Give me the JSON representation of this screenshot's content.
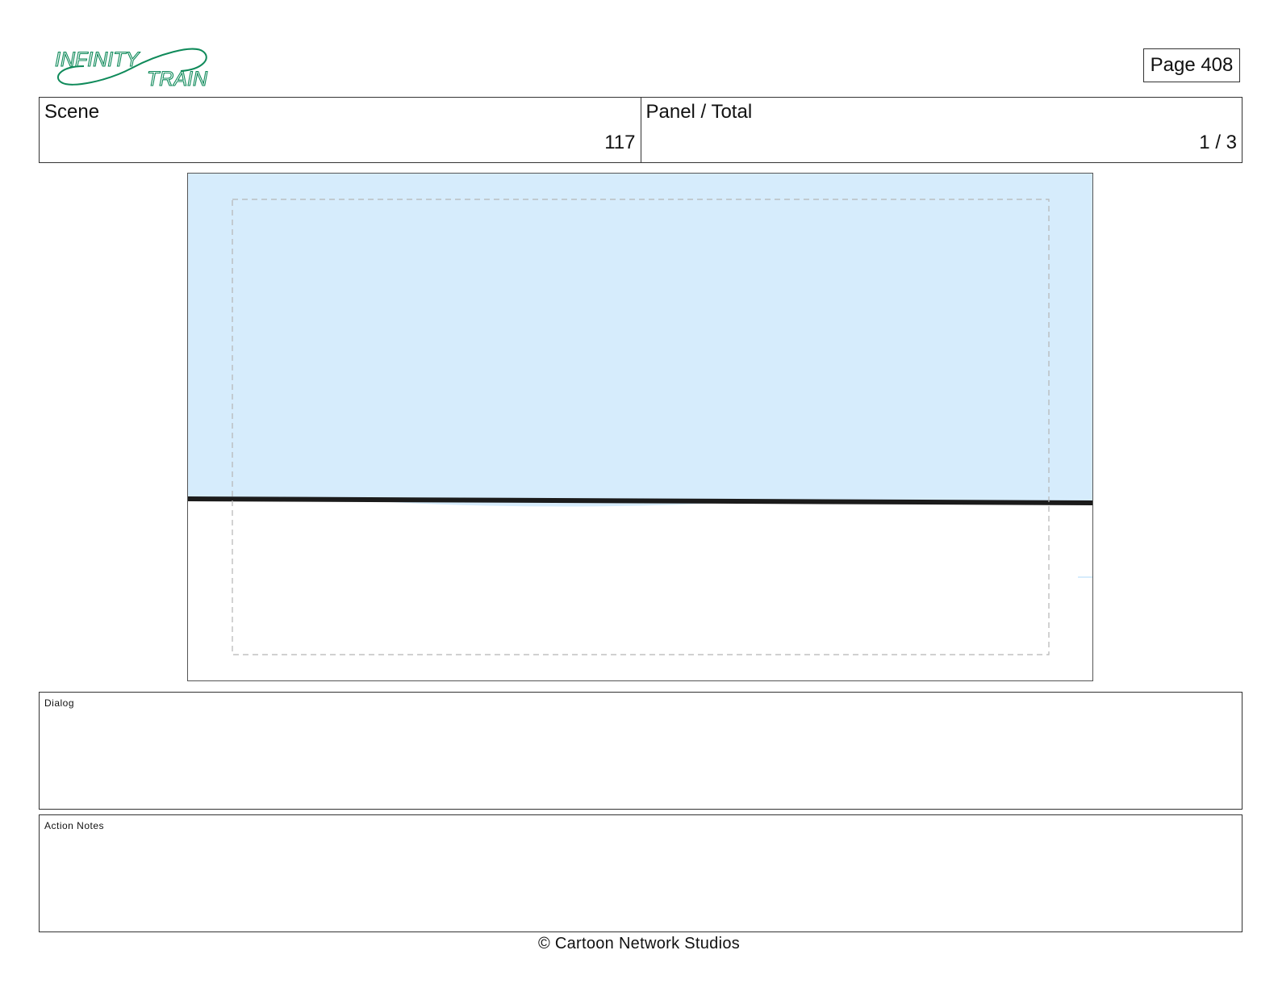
{
  "header": {
    "logo_text_line1": "INFINITY",
    "logo_text_line2": "TRAIN",
    "page_label": "Page 408",
    "brand_color": "#0f8a5a"
  },
  "info": {
    "scene_label": "Scene",
    "scene_value": "117",
    "panel_label": "Panel / Total",
    "panel_value": "1 / 3"
  },
  "panel": {
    "sky_color": "#d6ecfc",
    "horizon_color": "#1b1b1b",
    "safe_area_color": "#b5b5b5"
  },
  "dialog": {
    "label": "Dialog",
    "text": ""
  },
  "action_notes": {
    "label": "Action Notes",
    "text": ""
  },
  "footer": {
    "copyright": "© Cartoon Network Studios"
  }
}
